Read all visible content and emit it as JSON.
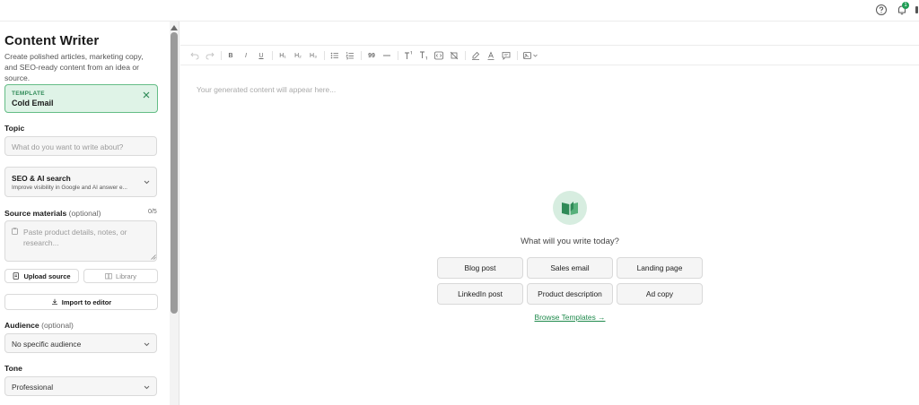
{
  "topbar": {
    "help_icon": "help-circle-icon",
    "notifications_icon": "bell-icon",
    "notification_count": "1"
  },
  "sidebar": {
    "title": "Content Writer",
    "subtitle": "Create polished articles, marketing copy, and SEO-ready content from an idea or source.",
    "template": {
      "label": "TEMPLATE",
      "name": "Cold Email"
    },
    "topic": {
      "label": "Topic",
      "placeholder": "What do you want to write about?"
    },
    "seo": {
      "title": "SEO & AI search",
      "description": "Improve visibility in Google and AI answer e..."
    },
    "source_materials": {
      "label": "Source materials",
      "optional": "(optional)",
      "count": "0/5",
      "placeholder": "Paste product details, notes, or research..."
    },
    "upload_source_label": "Upload source",
    "library_label": "Library",
    "import_label": "Import to editor",
    "audience": {
      "label": "Audience",
      "optional": "(optional)",
      "value": "No specific audience"
    },
    "tone": {
      "label": "Tone",
      "value": "Professional"
    }
  },
  "toolbar": {
    "items": [
      "undo",
      "redo",
      "bold",
      "italic",
      "underline",
      "heading-1",
      "heading-2",
      "heading-3",
      "bullet-list",
      "numbered-list",
      "quote",
      "horizontal-rule",
      "superscript",
      "subscript",
      "code",
      "clear-format",
      "highlight",
      "text-color",
      "comment",
      "image"
    ],
    "labels": {
      "bold": "B",
      "italic": "I",
      "underline": "U",
      "h1": "H₁",
      "h2": "H₂",
      "h3": "H₃",
      "quote": "99"
    }
  },
  "editor": {
    "placeholder": "Your generated content will appear here...",
    "empty_state": {
      "icon": "open-book-icon",
      "prompt": "What will you write today?",
      "quick_actions": [
        "Blog post",
        "Sales email",
        "Landing page",
        "LinkedIn post",
        "Product description",
        "Ad copy"
      ],
      "browse_link": "Browse Templates →"
    }
  },
  "colors": {
    "accent": "#1f8a4c",
    "template_bg": "#dff3e7",
    "template_border": "#64bd86"
  }
}
